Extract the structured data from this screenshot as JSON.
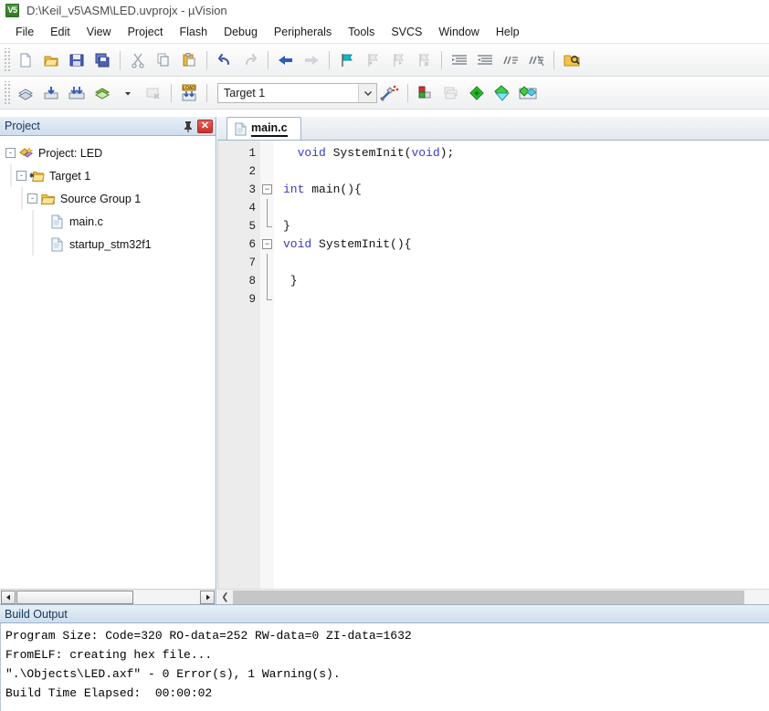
{
  "window": {
    "title": "D:\\Keil_v5\\ASM\\LED.uvprojx - µVision",
    "logo_text": "V5",
    "logo_icon": "uvision-logo-icon"
  },
  "menubar": {
    "items": [
      {
        "label": "File"
      },
      {
        "label": "Edit"
      },
      {
        "label": "View"
      },
      {
        "label": "Project"
      },
      {
        "label": "Flash"
      },
      {
        "label": "Debug"
      },
      {
        "label": "Peripherals"
      },
      {
        "label": "Tools"
      },
      {
        "label": "SVCS"
      },
      {
        "label": "Window"
      },
      {
        "label": "Help"
      }
    ]
  },
  "toolbar_main": {
    "buttons": [
      {
        "icon": "new-file-icon",
        "name": "new-file-button"
      },
      {
        "icon": "open-file-icon",
        "name": "open-file-button"
      },
      {
        "icon": "save-icon",
        "name": "save-button"
      },
      {
        "icon": "save-all-icon",
        "name": "save-all-button"
      },
      {
        "icon": "cut-icon",
        "name": "cut-button"
      },
      {
        "icon": "copy-icon",
        "name": "copy-button"
      },
      {
        "icon": "paste-icon",
        "name": "paste-button"
      },
      {
        "icon": "undo-icon",
        "name": "undo-button"
      },
      {
        "icon": "redo-icon",
        "name": "redo-button"
      },
      {
        "icon": "navigate-back-icon",
        "name": "back-button"
      },
      {
        "icon": "navigate-forward-icon",
        "name": "forward-button"
      },
      {
        "icon": "bookmark-toggle-icon",
        "name": "toggle-bookmark-button"
      },
      {
        "icon": "bookmark-prev-icon",
        "name": "previous-bookmark-button"
      },
      {
        "icon": "bookmark-next-icon",
        "name": "next-bookmark-button"
      },
      {
        "icon": "bookmark-clear-icon",
        "name": "clear-bookmarks-button"
      },
      {
        "icon": "indent-icon",
        "name": "indent-button"
      },
      {
        "icon": "outdent-icon",
        "name": "outdent-button"
      },
      {
        "icon": "comment-icon",
        "name": "comment-button"
      },
      {
        "icon": "uncomment-icon",
        "name": "uncomment-button"
      },
      {
        "icon": "find-in-files-icon",
        "name": "find-in-files-button"
      }
    ]
  },
  "toolbar_build": {
    "buttons": [
      {
        "icon": "translate-icon",
        "name": "translate-button"
      },
      {
        "icon": "build-icon",
        "name": "build-button"
      },
      {
        "icon": "rebuild-icon",
        "name": "rebuild-button"
      },
      {
        "icon": "batch-build-icon",
        "name": "batch-build-button"
      },
      {
        "icon": "stop-build-icon",
        "name": "stop-build-button"
      },
      {
        "icon": "download-icon",
        "name": "load-to-flash-button",
        "label": "LOAD"
      }
    ],
    "target_combo": {
      "value": "Target 1",
      "arrow_icon": "chevron-down-icon"
    },
    "right_buttons": [
      {
        "icon": "target-options-icon",
        "name": "target-options-button"
      },
      {
        "icon": "manage-project-items-icon",
        "name": "manage-project-items-button"
      },
      {
        "icon": "manage-multi-project-icon",
        "name": "manage-multi-project-button"
      },
      {
        "icon": "pack-installer-icon",
        "name": "pack-installer-button"
      },
      {
        "icon": "manage-run-time-env-icon",
        "name": "manage-rte-button"
      },
      {
        "icon": "select-software-packs-icon",
        "name": "select-software-packs-button"
      }
    ]
  },
  "project_panel": {
    "title": "Project",
    "pin_icon": "pin-icon",
    "close_icon": "close-icon",
    "tree": [
      {
        "level": 0,
        "label": "Project: LED",
        "icon": "project-icon",
        "expander": "-"
      },
      {
        "level": 1,
        "label": "Target 1",
        "icon": "target-folder-icon",
        "expander": "-"
      },
      {
        "level": 2,
        "label": "Source Group 1",
        "icon": "folder-icon",
        "expander": "-"
      },
      {
        "level": 3,
        "label": "main.c",
        "icon": "source-file-icon",
        "expander": ""
      },
      {
        "level": 3,
        "label": "startup_stm32f1",
        "icon": "source-file-icon",
        "expander": ""
      }
    ],
    "scrollbar": {
      "left_arrow_icon": "scroll-left-icon",
      "right_arrow_icon": "scroll-right-icon"
    }
  },
  "editor": {
    "tabs": [
      {
        "label": "main.c",
        "icon": "source-file-icon",
        "active": true
      }
    ],
    "line_numbers": [
      "1",
      "2",
      "3",
      "4",
      "5",
      "6",
      "7",
      "8",
      "9"
    ],
    "lines": [
      {
        "num": "1",
        "fold": "",
        "segments": [
          {
            "t": "  ",
            "c": ""
          },
          {
            "t": "void",
            "c": "kw"
          },
          {
            "t": " SystemInit(",
            "c": ""
          },
          {
            "t": "void",
            "c": "kw"
          },
          {
            "t": ");",
            "c": ""
          }
        ]
      },
      {
        "num": "2",
        "fold": "",
        "segments": [
          {
            "t": "",
            "c": ""
          }
        ]
      },
      {
        "num": "3",
        "fold": "box",
        "segments": [
          {
            "t": "int",
            "c": "kw"
          },
          {
            "t": " main(){",
            "c": ""
          }
        ]
      },
      {
        "num": "4",
        "fold": "line",
        "segments": [
          {
            "t": "",
            "c": ""
          }
        ]
      },
      {
        "num": "5",
        "fold": "end",
        "segments": [
          {
            "t": "}",
            "c": ""
          }
        ]
      },
      {
        "num": "6",
        "fold": "box",
        "segments": [
          {
            "t": "void",
            "c": "kw"
          },
          {
            "t": " SystemInit(){",
            "c": ""
          }
        ]
      },
      {
        "num": "7",
        "fold": "line",
        "segments": [
          {
            "t": "",
            "c": ""
          }
        ]
      },
      {
        "num": "8",
        "fold": "line",
        "segments": [
          {
            "t": " }",
            "c": ""
          }
        ]
      },
      {
        "num": "9",
        "fold": "end",
        "segments": [
          {
            "t": "",
            "c": ""
          }
        ]
      }
    ],
    "scrollbar": {
      "left_arrow_icon": "scroll-left-icon"
    }
  },
  "build_output": {
    "title": "Build Output",
    "lines": [
      "Program Size: Code=320 RO-data=252 RW-data=0 ZI-data=1632",
      "FromELF: creating hex file...",
      "\".\\Objects\\LED.axf\" - 0 Error(s), 1 Warning(s).",
      "Build Time Elapsed:  00:00:02"
    ]
  },
  "colors": {
    "keyword": "#3b3bc4",
    "panel_header_text": "#15365c",
    "close_button": "#c5312a",
    "brand_green": "#2f7a24"
  }
}
